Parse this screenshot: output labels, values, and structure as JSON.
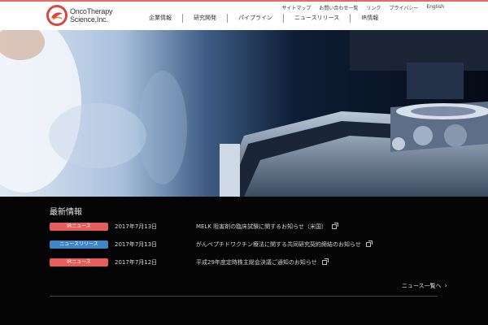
{
  "header": {
    "logo_line1": "OncoTherapy",
    "logo_line2": "Science,Inc.",
    "utility_links": [
      "サイトマップ",
      "お問い合わせ一覧",
      "リンク",
      "プライバシー",
      "English"
    ],
    "nav": [
      "企業情報",
      "研究開発",
      "パイプライン",
      "ニュースリリース",
      "IR情報"
    ]
  },
  "news": {
    "title": "最新情報",
    "items": [
      {
        "badge": "IRニュース",
        "badge_color": "#e35f5f",
        "date": "2017年7月13日",
        "headline": "MELK 阻害剤の臨床試験に関するお知らせ（米国）"
      },
      {
        "badge": "ニュースリリース",
        "badge_color": "#3f86c8",
        "date": "2017年7月13日",
        "headline": "がんペプチドワクチン療法に関する共同研究契約締結のお知らせ"
      },
      {
        "badge": "IRニュース",
        "badge_color": "#e35f5f",
        "date": "2017年7月12日",
        "headline": "平成29年度定時株主総会決議ご通知のお知らせ"
      }
    ],
    "more_label": "ニュース一覧へ"
  },
  "colors": {
    "accent": "#e86a63",
    "badge_red": "#e35f5f",
    "badge_blue": "#3f86c8"
  }
}
